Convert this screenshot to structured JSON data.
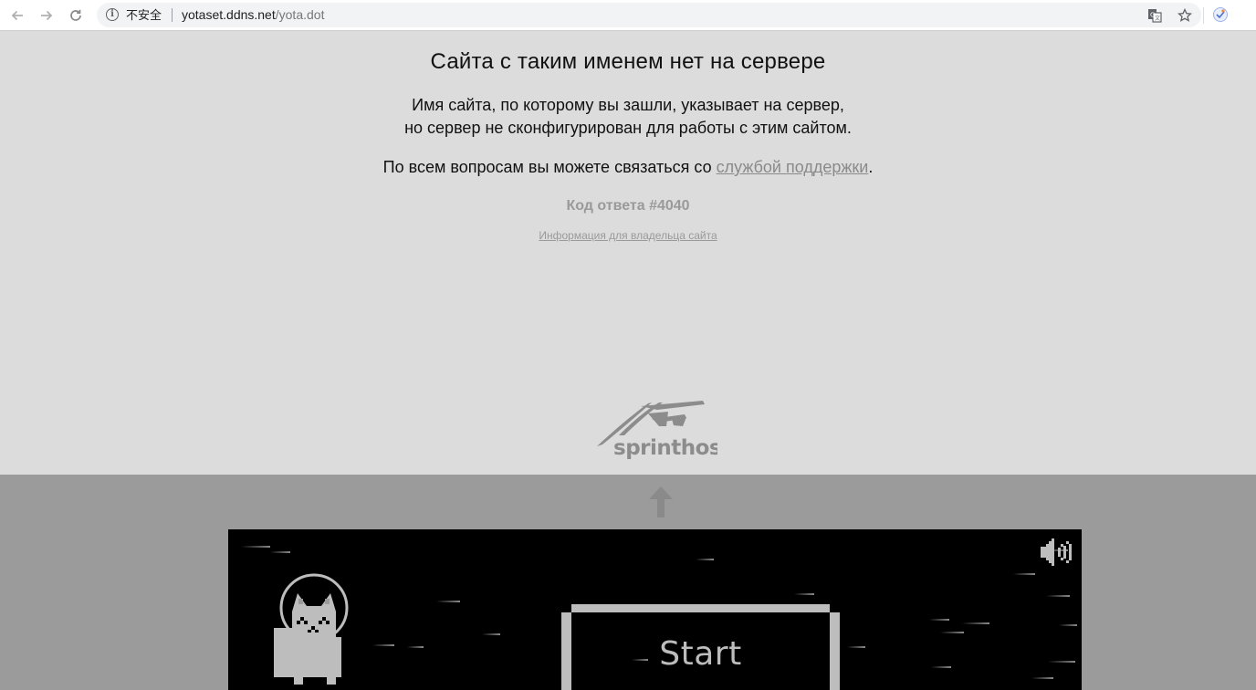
{
  "browser": {
    "security_label": "不安全",
    "url_host": "yotaset.ddns.net",
    "url_path": "/yota.dot",
    "icons": [
      "back-arrow-icon",
      "forward-arrow-icon",
      "reload-icon",
      "info-icon",
      "translate-icon",
      "bookmark-star-icon",
      "extension-icon"
    ]
  },
  "error_page": {
    "title": "Сайта с таким именем нет на сервере",
    "desc_line1": "Имя сайта, по которому вы зашли, указывает на сервер,",
    "desc_line2": "но сервер не сконфигурирован для работы с этим сайтом.",
    "contact_prefix": "По всем вопросам вы можете связаться со ",
    "contact_link": "службой поддержки",
    "contact_suffix": ".",
    "response_code": "Код ответа #4040",
    "owner_link": "Информация для владельца сайта",
    "logo_text": "sprinthost"
  },
  "game": {
    "start_label": "Start",
    "icons": [
      "up-arrow-icon",
      "sound-icon",
      "astronaut-cat-icon"
    ]
  },
  "colors": {
    "page_bg": "#dcdcdc",
    "game_band_bg": "#9b9b9b",
    "game_canvas_bg": "#000000",
    "start_frame": "#bdbdbd",
    "muted_text": "#9a9a9a"
  }
}
